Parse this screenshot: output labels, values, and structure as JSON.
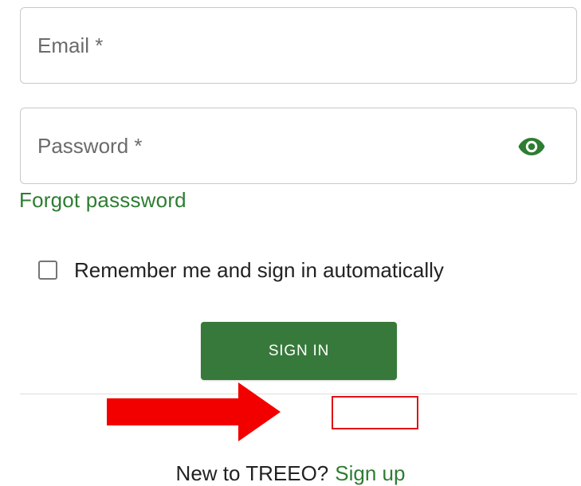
{
  "form": {
    "email": {
      "value": "",
      "placeholder": "Email *"
    },
    "password": {
      "value": "",
      "placeholder": "Password *",
      "toggle_icon": "eye-icon"
    },
    "forgot_password_label": "Forgot passsword",
    "remember_me_label": "Remember me and sign in automatically",
    "remember_me_checked": false,
    "sign_in_label": "SIGN IN"
  },
  "footer": {
    "prompt": "New to TREEO?",
    "signup_label": "Sign up"
  },
  "annotations": {
    "arrow_icon": "right-arrow-icon",
    "highlight": "highlight-box"
  },
  "colors": {
    "accent": "#2e7d32",
    "button": "#37793a",
    "annotation_red": "#e01212",
    "annotation_arrow": "#f20000"
  }
}
